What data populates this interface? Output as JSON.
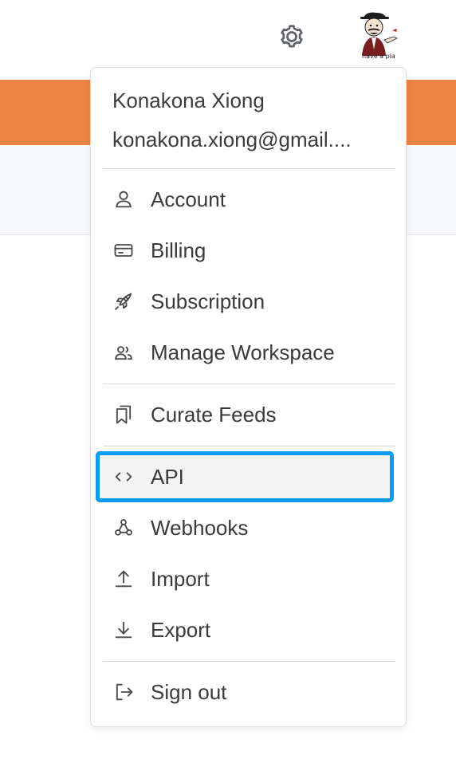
{
  "header": {
    "settings_icon": "gear-icon",
    "avatar_caption": "have a pla"
  },
  "user": {
    "name": "Konakona Xiong",
    "email": "konakona.xiong@gmail...."
  },
  "menu": {
    "account": {
      "label": "Account",
      "icon": "user-icon"
    },
    "billing": {
      "label": "Billing",
      "icon": "credit-card-icon"
    },
    "subscription": {
      "label": "Subscription",
      "icon": "rocket-icon"
    },
    "workspace": {
      "label": "Manage Workspace",
      "icon": "users-icon"
    },
    "feeds": {
      "label": "Curate Feeds",
      "icon": "bookmarks-icon"
    },
    "api": {
      "label": "API",
      "icon": "code-icon",
      "selected": true
    },
    "webhooks": {
      "label": "Webhooks",
      "icon": "webhook-icon"
    },
    "import": {
      "label": "Import",
      "icon": "upload-icon"
    },
    "export": {
      "label": "Export",
      "icon": "download-icon"
    },
    "signout": {
      "label": "Sign out",
      "icon": "logout-icon"
    }
  },
  "colors": {
    "accent_bar": "#ee8443",
    "selection_border": "#0a9cf5",
    "selected_bg": "#f4f4f4"
  }
}
